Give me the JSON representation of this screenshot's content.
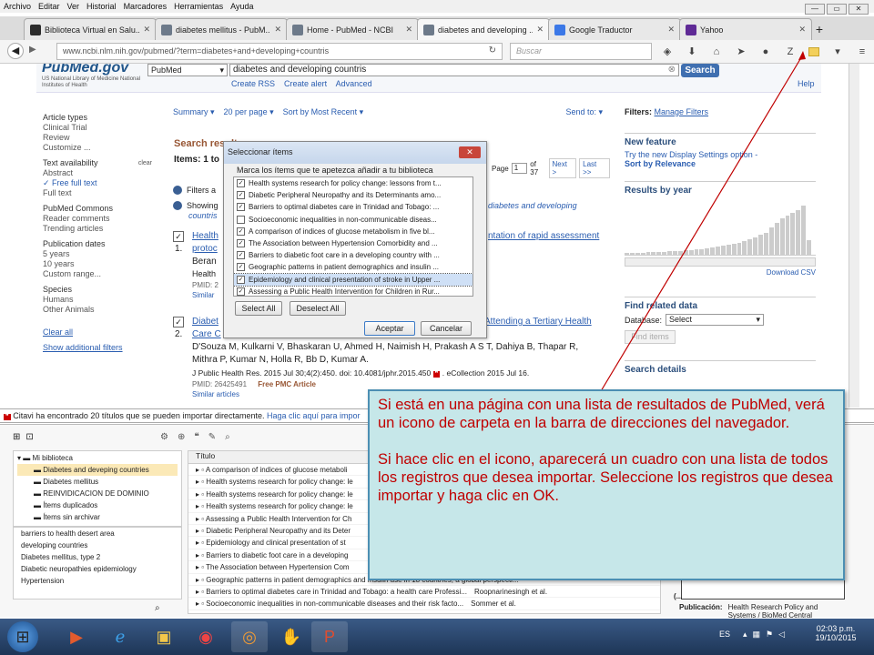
{
  "menu": [
    "Archivo",
    "Editar",
    "Ver",
    "Historial",
    "Marcadores",
    "Herramientas",
    "Ayuda"
  ],
  "tabs": [
    {
      "label": "Biblioteca Virtual en Salu...",
      "active": false,
      "color": "#2b2b2b"
    },
    {
      "label": "diabetes mellitus - PubM...",
      "active": false,
      "color": "#6d7a8a"
    },
    {
      "label": "Home - PubMed - NCBI",
      "active": false,
      "color": "#6d7a8a"
    },
    {
      "label": "diabetes and developing ...",
      "active": true,
      "color": "#6d7a8a"
    },
    {
      "label": "Google Traductor",
      "active": false,
      "color": "#3b78e7"
    },
    {
      "label": "Yahoo",
      "active": false,
      "color": "#5f2a96"
    }
  ],
  "url": "www.ncbi.nlm.nih.gov/pubmed/?term=diabetes+and+developing+countris",
  "search_placeholder": "Buscar",
  "pubmed": {
    "logo": "PubMed.gov",
    "org": "US National Library of Medicine National Institutes of Health",
    "db": "PubMed",
    "query": "diabetes and developing countris",
    "search_btn": "Search",
    "create_rss": "Create RSS",
    "create_alert": "Create alert",
    "advanced": "Advanced",
    "help": "Help",
    "summary": "Summary ▾",
    "per_page": "20 per page ▾",
    "sort": "Sort by Most Recent ▾",
    "send_to": "Send to: ▾",
    "search_results": "Search results",
    "items": "Items: 1 to",
    "page_label": "Page",
    "page": "1",
    "of": "of 37",
    "next": "Next >",
    "last": "Last >>",
    "filters_a": "Filters a",
    "showing": "Showing",
    "showing2": "countris",
    "showing_link": "diabetes and developing",
    "r1_num": "1.",
    "r1_title": "Health",
    "r1_title2": "protoc",
    "r1_title_tail": "ntation of rapid assessment",
    "r1_auth": "Beran",
    "r1_journ": "Health",
    "r1_pmid": "PMID: 2",
    "r1_sim": "Similar",
    "r2_num": "2.",
    "r2_title": "Diabet",
    "r2_title2": "Care C",
    "r2_title_tail": "Attending a Tertiary Health",
    "r2_auth": "D'Souza M, Kulkarni V, Bhaskaran U, Ahmed H, Naimish H, Prakash A S T, Dahiya B, Thapar R,",
    "r2_auth2": "Mithra P, Kumar N, Holla R, Bb D, Kumar A.",
    "r2_journ": "J Public Health Res. 2015 Jul 30;4(2):450. doi: 10.4081/jphr.2015.450",
    "r2_epub": ". eCollection 2015 Jul 16.",
    "r2_pmid": "PMID: 26425491",
    "r2_free": "Free PMC Article",
    "r2_sim": "Similar articles"
  },
  "sidebar": [
    {
      "h": "Article types",
      "items": [
        "Clinical Trial",
        "Review",
        "Customize ..."
      ]
    },
    {
      "h": "Text availability",
      "clear": "clear",
      "items": [
        "Abstract",
        "✓ Free full text",
        "Full text"
      ]
    },
    {
      "h": "PubMed Commons",
      "items": [
        "Reader comments",
        "Trending articles"
      ]
    },
    {
      "h": "Publication dates",
      "items": [
        "5 years",
        "10 years",
        "Custom range..."
      ]
    },
    {
      "h": "Species",
      "items": [
        "Humans",
        "Other Animals"
      ]
    }
  ],
  "sidebar_links": [
    "Clear all",
    "Show additional filters"
  ],
  "right": {
    "filters": "Filters:",
    "manage": "Manage Filters",
    "new_feature": "New feature",
    "nf_text": "Try the new Display Settings option -",
    "nf_bold": "Sort by Relevance",
    "results_by_year": "Results by year",
    "download": "Download CSV",
    "find_related": "Find related data",
    "database": "Database:",
    "db_select": "Select",
    "find_items": "Find items",
    "search_details": "Search details"
  },
  "year_bars": [
    0.03,
    0.03,
    0.04,
    0.04,
    0.05,
    0.05,
    0.06,
    0.06,
    0.07,
    0.07,
    0.08,
    0.09,
    0.1,
    0.11,
    0.12,
    0.13,
    0.14,
    0.16,
    0.18,
    0.2,
    0.22,
    0.25,
    0.28,
    0.32,
    0.36,
    0.4,
    0.45,
    0.55,
    0.65,
    0.75,
    0.8,
    0.85,
    0.9,
    1.0,
    0.3
  ],
  "dialog": {
    "title": "Seleccionar ítems",
    "close": "✕",
    "msg": "Marca los ítems que te apetezca añadir a tu biblioteca",
    "items": [
      "Health systems research for policy change: lessons from t...",
      "Diabetic Peripheral Neuropathy and its Determinants amo...",
      "Barriers to optimal diabetes care in Trinidad and Tobago: ...",
      "Socioeconomic inequalities in non-communicable diseas...",
      "A comparison of indices of glucose metabolism in five bl...",
      "The Association between Hypertension Comorbidity and ...",
      "Barriers to diabetic foot care in a developing country with ...",
      "Geographic patterns in patient demographics and insulin ...",
      "Epidemiology and clinical presentation of stroke in Upper ...",
      "Assessing a Public Health Intervention for Children in Rur..."
    ],
    "unchecked_index": 3,
    "selected_index": 8,
    "select_all": "Select All",
    "deselect_all": "Deselect All",
    "accept": "Aceptar",
    "cancel": "Cancelar"
  },
  "citavi": {
    "msg": "Citavi ha encontrado 20 títulos que se pueden importar directamente.",
    "link": "Haga clic aquí para impor"
  },
  "library": {
    "root": "Mi biblioteca",
    "items": [
      "Diabetes and deveping countries",
      "Diabetes mellitus",
      "REINVIDICACION DE DOMINIO",
      "Ítems duplicados",
      "Ítems sin archivar"
    ],
    "keywords": [
      "barriers to health   desert area",
      "developing countries",
      "Diabetes mellitus, type 2",
      "Diabetic neuropathies   epidemiology",
      "Hypertension"
    ],
    "col_title": "Título",
    "rows": [
      "A comparison of indices of glucose metaboli",
      "Health systems research for policy change: le",
      "Health systems research for policy change: le",
      "Health systems research for policy change: le",
      "Assessing a Public Health Intervention for Ch",
      "Diabetic Peripheral Neuropathy and its Deter",
      "Epidemiology and clinical presentation of st",
      "Barriers to diabetic foot care in a developing",
      "The Association between Hypertension Com",
      "Geographic patterns in patient demographics and insulin use in 18 countries, a global perspecti...",
      "Barriers to optimal diabetes care in Trinidad and Tobago: a health care Professi...",
      "Socioeconomic inequalities in non-communicable diseases and their risk facto..."
    ],
    "row_authors": [
      "",
      "",
      "",
      "",
      "",
      "",
      "",
      "",
      "",
      "",
      "Roopnarinesingh et al.",
      "Sommer et al."
    ],
    "pub_label": "Publicación:",
    "pub_value": "Health Research Policy and Systems / BioMed Central"
  },
  "callout": {
    "p1": "Si está en una página con una lista de resultados de PubMed, verá un icono de carpeta en la barra de direcciones del navegador.",
    "p2": "Si hace clic en el icono, aparecerá un cuadro con una lista de todos los registros que desea importar. Seleccione los registros que desea importar y haga clic en OK."
  },
  "taskbar": {
    "lang": "ES",
    "time": "02:03 p.m.",
    "date": "19/10/2015"
  },
  "colors": {
    "accent": "#3f6fb0",
    "callout_text": "#c00000",
    "callout_bg": "#c6e7e9"
  }
}
